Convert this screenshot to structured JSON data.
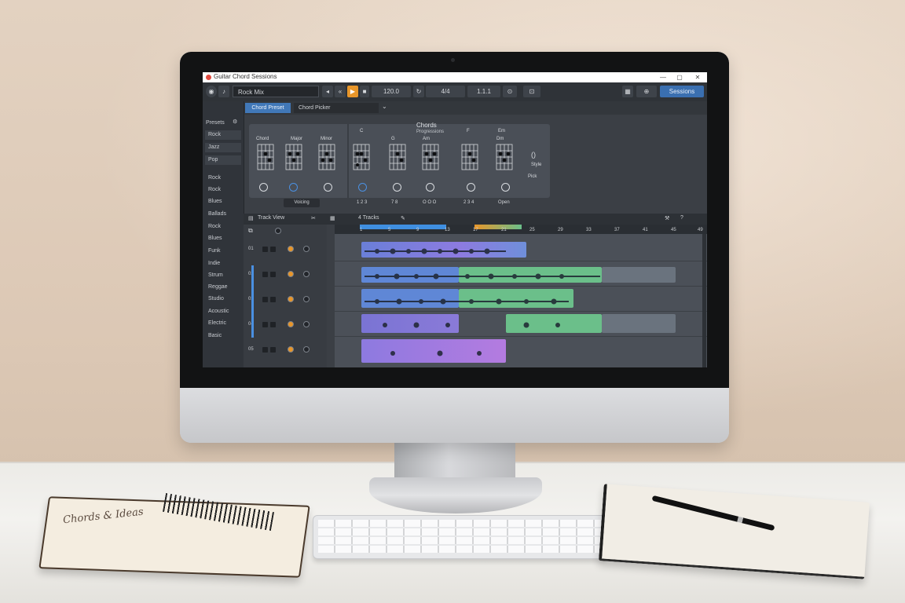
{
  "window": {
    "title": "Guitar Chord Sessions",
    "controls": [
      "—",
      "▢",
      "✕"
    ]
  },
  "toolbar": {
    "search_value": "Rock Mix",
    "tempo_readout": "120.0",
    "time_readout": "4/4",
    "position_readout": "1.1.1",
    "right_button": "Sessions"
  },
  "subbar": {
    "tab_label": "Chord Preset",
    "preset_value": "Chord Picker"
  },
  "sidebar": {
    "heading": "Presets",
    "items": [
      "Rock",
      "Jazz",
      "Pop",
      "Rock",
      "Rock",
      "Blues",
      "Ballads",
      "Rock",
      "Blues",
      "Funk",
      "Indie",
      "Strum",
      "Reggae",
      "Studio",
      "Acoustic",
      "Electric",
      "Basic"
    ]
  },
  "chord_panel": {
    "title": "Chords",
    "subtitle": "Progressions",
    "left_names": [
      "Chord",
      "Major",
      "Minor"
    ],
    "right_names": [
      "C",
      "G",
      "Am",
      "F",
      "Em",
      "Dm"
    ],
    "extra_label": "Style",
    "extra_value": "Pick",
    "voicing_button": "Voicing",
    "bottom_labels": [
      "1 2 3",
      "7 8",
      "O O O",
      "2 3 4",
      "Open"
    ]
  },
  "arranger": {
    "bar_label": "Track View",
    "track_count_label": "4 Tracks",
    "ruler_marks": [
      "1",
      "5",
      "9",
      "13",
      "17",
      "21",
      "25",
      "29",
      "33",
      "37",
      "41",
      "45",
      "49"
    ],
    "tracks": [
      "01",
      "02",
      "03",
      "04",
      "05"
    ]
  },
  "colors": {
    "accent_blue": "#4a90e2",
    "clip_blue": "#5f87d6",
    "clip_green": "#6bbf8a",
    "clip_purple": "#9a7be0",
    "transport_orange": "#e8962a"
  },
  "desk": {
    "notebook_scribble": "Chords & Ideas"
  }
}
